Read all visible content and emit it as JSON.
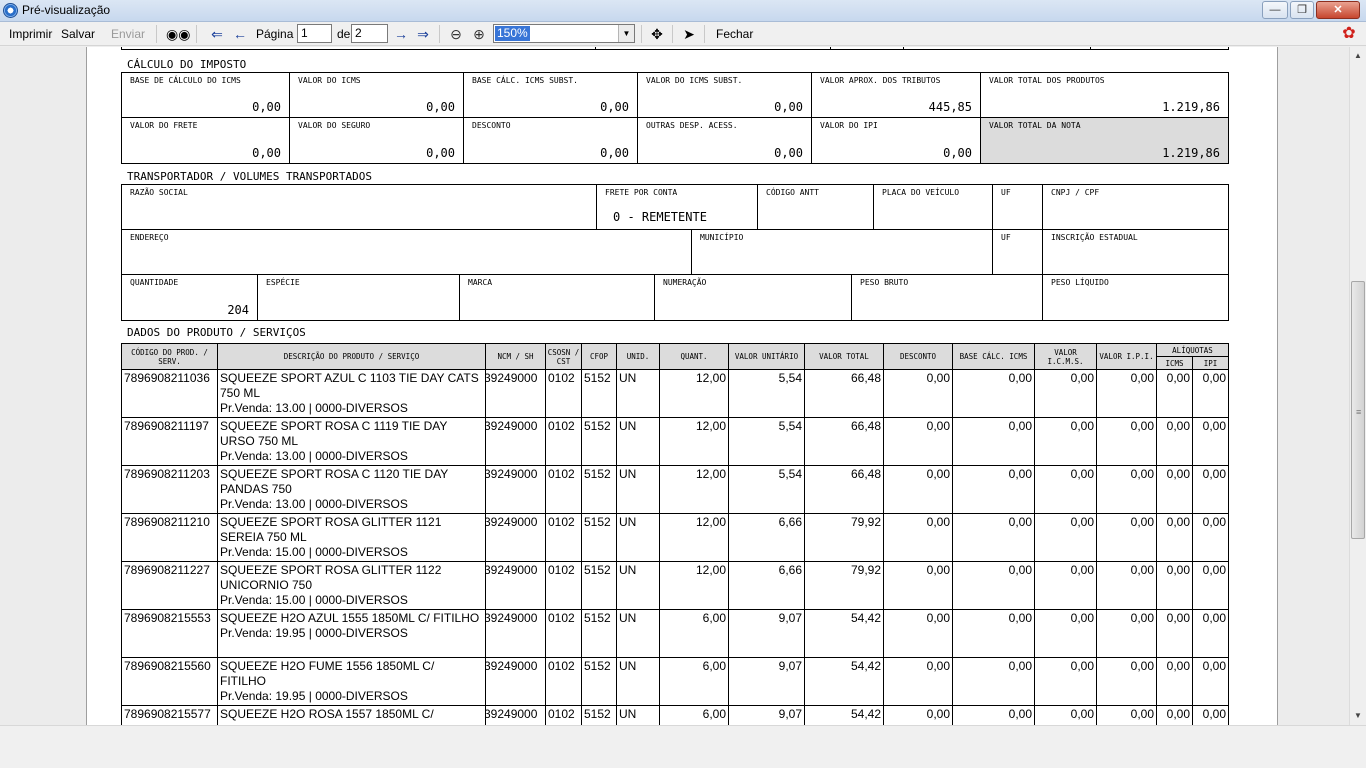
{
  "window": {
    "title": "Pré-visualização"
  },
  "toolbar": {
    "print": "Imprimir",
    "save": "Salvar",
    "send": "Enviar",
    "page_label": "Página",
    "page_value": "1",
    "of_label": "de",
    "of_value": "2",
    "zoom": "150%",
    "close": "Fechar"
  },
  "tax": {
    "section_title": "CÁLCULO DO IMPOSTO",
    "row1": [
      {
        "label": "BASE DE CÁLCULO DO ICMS",
        "value": "0,00"
      },
      {
        "label": "VALOR DO ICMS",
        "value": "0,00"
      },
      {
        "label": "BASE CÁLC. ICMS SUBST.",
        "value": "0,00"
      },
      {
        "label": "VALOR DO ICMS SUBST.",
        "value": "0,00"
      },
      {
        "label": "VALOR APROX. DOS TRIBUTOS",
        "value": "445,85"
      },
      {
        "label": "VALOR TOTAL DOS PRODUTOS",
        "value": "1.219,86"
      }
    ],
    "row2": [
      {
        "label": "VALOR DO FRETE",
        "value": "0,00"
      },
      {
        "label": "VALOR DO SEGURO",
        "value": "0,00"
      },
      {
        "label": "DESCONTO",
        "value": "0,00"
      },
      {
        "label": "OUTRAS DESP. ACESS.",
        "value": "0,00"
      },
      {
        "label": "VALOR DO IPI",
        "value": "0,00"
      },
      {
        "label": "VALOR TOTAL DA NOTA",
        "value": "1.219,86"
      }
    ]
  },
  "transport": {
    "section_title": "TRANSPORTADOR / VOLUMES TRANSPORTADOS",
    "row1": [
      {
        "label": "RAZÃO SOCIAL",
        "value": ""
      },
      {
        "label": "FRETE POR CONTA",
        "value": "0 - REMETENTE"
      },
      {
        "label": "CÓDIGO ANTT",
        "value": ""
      },
      {
        "label": "PLACA DO VEÍCULO",
        "value": ""
      },
      {
        "label": "UF",
        "value": ""
      },
      {
        "label": "CNPJ / CPF",
        "value": ""
      }
    ],
    "row2": [
      {
        "label": "ENDEREÇO",
        "value": ""
      },
      {
        "label": "MUNICÍPIO",
        "value": ""
      },
      {
        "label": "UF",
        "value": ""
      },
      {
        "label": "INSCRIÇÃO ESTADUAL",
        "value": ""
      }
    ],
    "row3": [
      {
        "label": "QUANTIDADE",
        "value": "204"
      },
      {
        "label": "ESPÉCIE",
        "value": ""
      },
      {
        "label": "MARCA",
        "value": ""
      },
      {
        "label": "NUMERAÇÃO",
        "value": ""
      },
      {
        "label": "PESO BRUTO",
        "value": ""
      },
      {
        "label": "PESO LÍQUIDO",
        "value": ""
      }
    ]
  },
  "products": {
    "section_title": "DADOS DO PRODUTO / SERVIÇOS",
    "headers": {
      "code": "CÓDIGO DO PROD. / SERV.",
      "desc": "DESCRIÇÃO DO PRODUTO / SERVIÇO",
      "ncm": "NCM / SH",
      "csosn": "CSOSN / CST",
      "cfop": "CFOP",
      "unid": "UNID.",
      "quant": "QUANT.",
      "vunit": "VALOR UNITÁRIO",
      "vtotal": "VALOR TOTAL",
      "desconto": "DESCONTO",
      "base": "BASE CÁLC. ICMS",
      "vicms": "VALOR I.C.M.S.",
      "vipi": "VALOR I.P.I.",
      "aliquotas": "ALÍQUOTAS",
      "icms": "ICMS",
      "ipi": "IPI"
    },
    "rows": [
      {
        "code": "7896908211036",
        "desc": "SQUEEZE SPORT AZUL C 1103 TIE DAY CATS 750 ML",
        "obs": "Pr.Venda: 13.00 | 0000-DIVERSOS",
        "ncm": "39249000",
        "csosn": "0102",
        "cfop": "5152",
        "unid": "UN",
        "quant": "12,00",
        "vunit": "5,54",
        "vtotal": "66,48",
        "desconto": "0,00",
        "base": "0,00",
        "vicms": "0,00",
        "vipi": "0,00",
        "icms": "0,00",
        "ipi": "0,00"
      },
      {
        "code": "7896908211197",
        "desc": "SQUEEZE SPORT ROSA C 1119 TIE DAY URSO 750 ML",
        "obs": "Pr.Venda: 13.00 | 0000-DIVERSOS",
        "ncm": "39249000",
        "csosn": "0102",
        "cfop": "5152",
        "unid": "UN",
        "quant": "12,00",
        "vunit": "5,54",
        "vtotal": "66,48",
        "desconto": "0,00",
        "base": "0,00",
        "vicms": "0,00",
        "vipi": "0,00",
        "icms": "0,00",
        "ipi": "0,00"
      },
      {
        "code": "7896908211203",
        "desc": "SQUEEZE SPORT ROSA C 1120 TIE DAY PANDAS 750",
        "obs": "Pr.Venda: 13.00 | 0000-DIVERSOS",
        "ncm": "39249000",
        "csosn": "0102",
        "cfop": "5152",
        "unid": "UN",
        "quant": "12,00",
        "vunit": "5,54",
        "vtotal": "66,48",
        "desconto": "0,00",
        "base": "0,00",
        "vicms": "0,00",
        "vipi": "0,00",
        "icms": "0,00",
        "ipi": "0,00"
      },
      {
        "code": "7896908211210",
        "desc": "SQUEEZE SPORT ROSA GLITTER 1121 SEREIA 750 ML",
        "obs": "Pr.Venda: 15.00 | 0000-DIVERSOS",
        "ncm": "39249000",
        "csosn": "0102",
        "cfop": "5152",
        "unid": "UN",
        "quant": "12,00",
        "vunit": "6,66",
        "vtotal": "79,92",
        "desconto": "0,00",
        "base": "0,00",
        "vicms": "0,00",
        "vipi": "0,00",
        "icms": "0,00",
        "ipi": "0,00"
      },
      {
        "code": "7896908211227",
        "desc": "SQUEEZE SPORT ROSA GLITTER 1122 UNICORNIO 750",
        "obs": "Pr.Venda: 15.00 | 0000-DIVERSOS",
        "ncm": "39249000",
        "csosn": "0102",
        "cfop": "5152",
        "unid": "UN",
        "quant": "12,00",
        "vunit": "6,66",
        "vtotal": "79,92",
        "desconto": "0,00",
        "base": "0,00",
        "vicms": "0,00",
        "vipi": "0,00",
        "icms": "0,00",
        "ipi": "0,00"
      },
      {
        "code": "7896908215553",
        "desc": "SQUEEZE H2O AZUL 1555 1850ML C/ FITILHO",
        "obs": "Pr.Venda: 19.95 | 0000-DIVERSOS",
        "ncm": "39249000",
        "csosn": "0102",
        "cfop": "5152",
        "unid": "UN",
        "quant": "6,00",
        "vunit": "9,07",
        "vtotal": "54,42",
        "desconto": "0,00",
        "base": "0,00",
        "vicms": "0,00",
        "vipi": "0,00",
        "icms": "0,00",
        "ipi": "0,00"
      },
      {
        "code": "7896908215560",
        "desc": "SQUEEZE H2O FUME 1556 1850ML C/ FITILHO",
        "obs": "Pr.Venda: 19.95 | 0000-DIVERSOS",
        "ncm": "39249000",
        "csosn": "0102",
        "cfop": "5152",
        "unid": "UN",
        "quant": "6,00",
        "vunit": "9,07",
        "vtotal": "54,42",
        "desconto": "0,00",
        "base": "0,00",
        "vicms": "0,00",
        "vipi": "0,00",
        "icms": "0,00",
        "ipi": "0,00"
      },
      {
        "code": "7896908215577",
        "desc": "SQUEEZE H2O ROSA 1557 1850ML C/",
        "obs": "",
        "ncm": "39249000",
        "csosn": "0102",
        "cfop": "5152",
        "unid": "UN",
        "quant": "6,00",
        "vunit": "9,07",
        "vtotal": "54,42",
        "desconto": "0,00",
        "base": "0,00",
        "vicms": "0,00",
        "vipi": "0,00",
        "icms": "0,00",
        "ipi": "0,00"
      }
    ]
  }
}
